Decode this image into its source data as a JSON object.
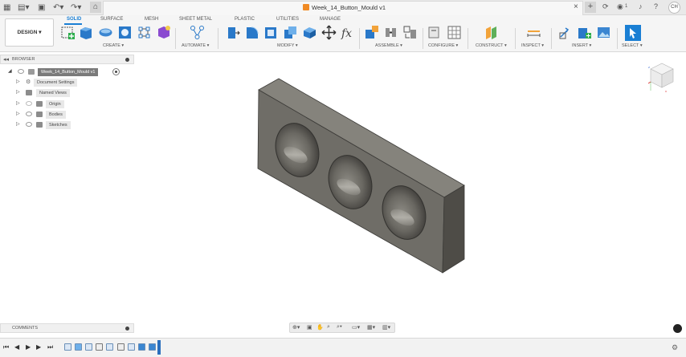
{
  "titlebar": {
    "doc_title": "Week_14_Button_Mould v1",
    "close_glyph": "×",
    "new_tab_glyph": "+",
    "notifications_badge": "1",
    "user_initials": "CH",
    "icons": [
      "grid-icon",
      "file-icon",
      "save-icon",
      "undo-icon",
      "redo-icon",
      "home-icon",
      "refresh-icon",
      "bell-icon",
      "help-icon"
    ]
  },
  "workspace": {
    "label": "DESIGN ▾"
  },
  "tabs": [
    "SOLID",
    "SURFACE",
    "MESH",
    "SHEET METAL",
    "PLASTIC",
    "UTILITIES",
    "MANAGE"
  ],
  "tool_groups": {
    "create": "CREATE ▾",
    "automate": "AUTOMATE ▾",
    "modify": "MODIFY ▾",
    "assemble": "ASSEMBLE ▾",
    "configure": "CONFIGURE ▾",
    "construct": "CONSTRUCT ▾",
    "inspect": "INSPECT ▾",
    "insert": "INSERT ▾",
    "select": "SELECT ▾"
  },
  "browser": {
    "title": "BROWSER",
    "root": "Week_14_Button_Mould v1",
    "items": [
      {
        "label": "Document Settings"
      },
      {
        "label": "Named Views"
      },
      {
        "label": "Origin"
      },
      {
        "label": "Bodies"
      },
      {
        "label": "Sketches"
      }
    ]
  },
  "comments": {
    "title": "COMMENTS"
  },
  "colors": {
    "accent": "#1a7fd4",
    "body_face": "#6f6d67",
    "body_top": "#85837c",
    "body_side": "#4e4c47"
  }
}
